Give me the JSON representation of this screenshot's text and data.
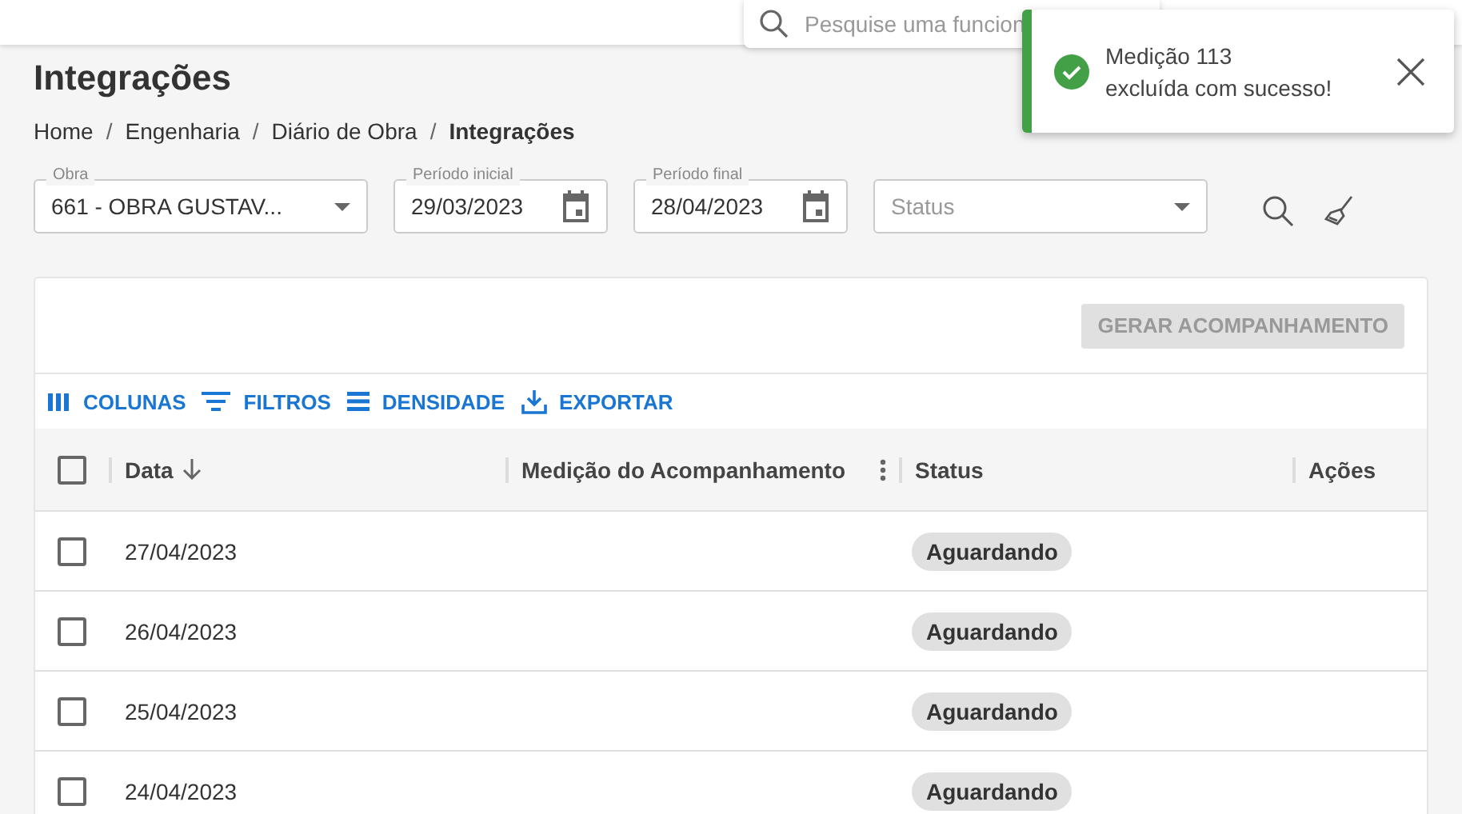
{
  "topbar": {
    "search": {
      "placeholder": "Pesquise uma funcion"
    }
  },
  "toast": {
    "lines": [
      "Medição 113",
      "excluída com sucesso!"
    ]
  },
  "page": {
    "title": "Integrações",
    "breadcrumb_separator": "/",
    "breadcrumb": [
      {
        "label": "Home",
        "current": false
      },
      {
        "label": "Engenharia",
        "current": false
      },
      {
        "label": "Diário de Obra",
        "current": false
      },
      {
        "label": "Integrações",
        "current": true
      }
    ]
  },
  "filters": [
    {
      "kind": "select",
      "label": "Obra",
      "value": "661 - OBRA GUSTAV..."
    },
    {
      "kind": "date",
      "label": "Período inicial",
      "value": "29/03/2023"
    },
    {
      "kind": "date",
      "label": "Período final",
      "value": "28/04/2023"
    },
    {
      "kind": "select",
      "placeholder": "Status"
    }
  ],
  "generate_button": {
    "label": "GERAR ACOMPANHAMENTO",
    "disabled": true
  },
  "toolbar": [
    {
      "kind": "columns",
      "label": "COLUNAS"
    },
    {
      "kind": "filters",
      "label": "FILTROS"
    },
    {
      "kind": "density",
      "label": "DENSIDADE"
    },
    {
      "kind": "export",
      "label": "EXPORTAR"
    }
  ],
  "table": {
    "select_all": {
      "checked": false
    },
    "columns": [
      "Data",
      "Medição do Acompanhamento",
      "Status",
      "Ações"
    ],
    "rows": [
      {
        "checked": false,
        "date": "27/04/2023",
        "status": "Aguardando"
      },
      {
        "checked": false,
        "date": "26/04/2023",
        "status": "Aguardando"
      },
      {
        "checked": false,
        "date": "25/04/2023",
        "status": "Aguardando"
      },
      {
        "checked": false,
        "date": "24/04/2023",
        "status": "Aguardando"
      }
    ]
  }
}
